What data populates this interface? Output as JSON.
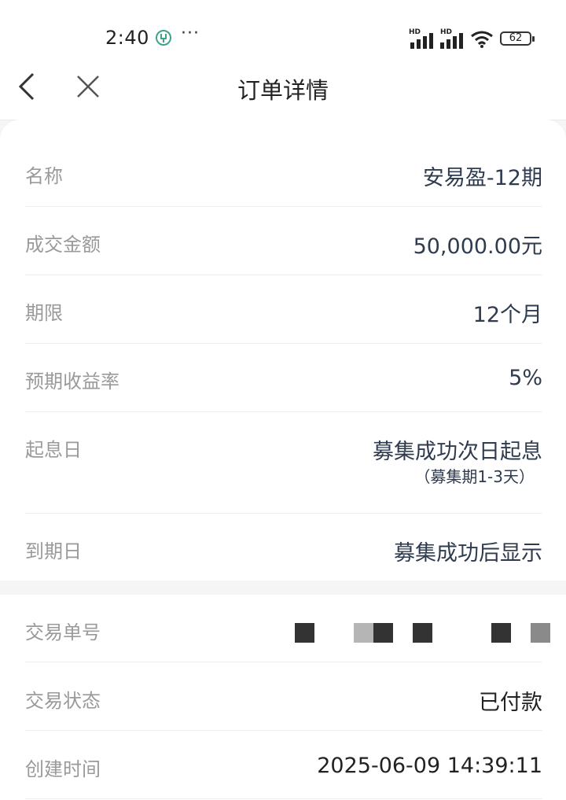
{
  "status_bar": {
    "time": "2:40",
    "more": "···",
    "signal_label_1": "HD",
    "signal_label_2": "HD",
    "battery": "62"
  },
  "nav": {
    "title": "订单详情"
  },
  "order": {
    "rows": [
      {
        "label": "名称",
        "value": "安易盈-12期"
      },
      {
        "label": "成交金额",
        "value": "50,000.00元"
      },
      {
        "label": "期限",
        "value": "12个月"
      },
      {
        "label": "预期收益率",
        "value": "5%"
      },
      {
        "label": "起息日",
        "value": "募集成功次日起息",
        "subvalue": "（募集期1-3天）"
      },
      {
        "label": "到期日",
        "value": "募集成功后显示"
      }
    ]
  },
  "transaction": {
    "rows": [
      {
        "label": "交易单号",
        "value": ""
      },
      {
        "label": "交易状态",
        "value": "已付款"
      },
      {
        "label": "创建时间",
        "value": "2025-06-09 14:39:11"
      }
    ]
  }
}
